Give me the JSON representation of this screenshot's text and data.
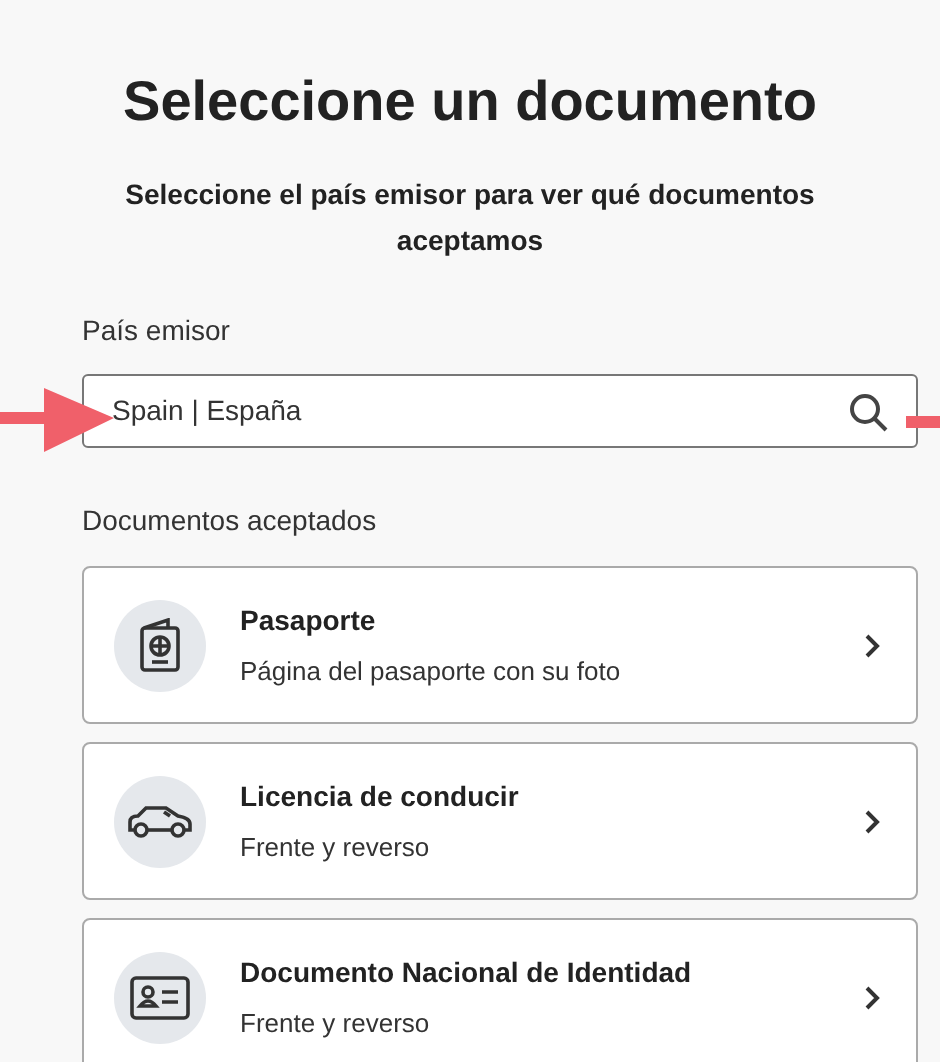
{
  "title": "Seleccione un documento",
  "subtitle": "Seleccione el país emisor para ver qué documentos aceptamos",
  "country_field": {
    "label": "País emisor",
    "value": "Spain | España"
  },
  "documents_label": "Documentos aceptados",
  "documents": [
    {
      "kind": "passport",
      "title": "Pasaporte",
      "description": "Página del pasaporte con su foto"
    },
    {
      "kind": "car",
      "title": "Licencia de conducir",
      "description": "Frente y reverso"
    },
    {
      "kind": "id-card",
      "title": "Documento Nacional de Identidad",
      "description": "Frente y reverso"
    }
  ]
}
